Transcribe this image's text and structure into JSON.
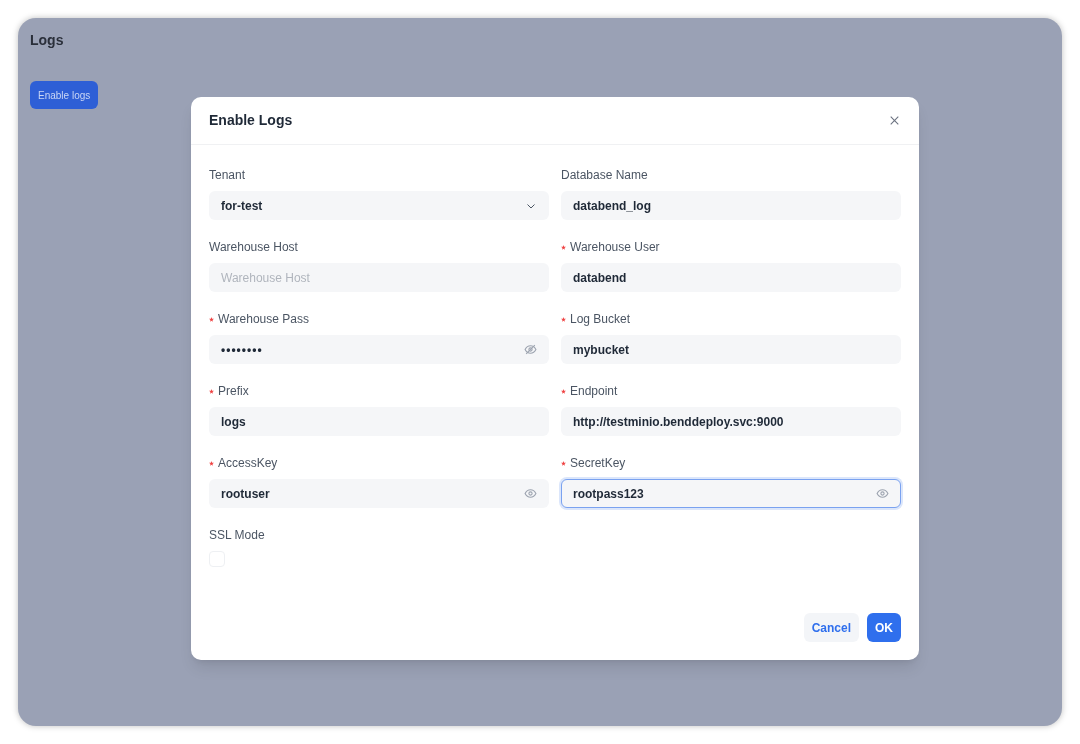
{
  "page": {
    "title": "Logs",
    "action_button": "Enable logs"
  },
  "dialog": {
    "title": "Enable Logs",
    "fields": [
      {
        "kind": "select",
        "label": "Tenant",
        "required": false,
        "value": "for-test",
        "focused": false
      },
      {
        "kind": "text",
        "label": "Database Name",
        "required": false,
        "value": "databend_log",
        "focused": false
      },
      {
        "kind": "text",
        "label": "Warehouse Host",
        "required": false,
        "placeholder": "Warehouse Host",
        "focused": false
      },
      {
        "kind": "text",
        "label": "Warehouse User",
        "required": true,
        "value": "databend",
        "focused": false
      },
      {
        "kind": "password",
        "label": "Warehouse Pass",
        "required": true,
        "value": "••••••••",
        "revealed": false,
        "focused": false
      },
      {
        "kind": "text",
        "label": "Log Bucket",
        "required": true,
        "value": "mybucket",
        "focused": false
      },
      {
        "kind": "text",
        "label": "Prefix",
        "required": true,
        "value": "logs",
        "focused": false
      },
      {
        "kind": "text",
        "label": "Endpoint",
        "required": true,
        "value": "http://testminio.benddeploy.svc:9000",
        "focused": false
      },
      {
        "kind": "password",
        "label": "AccessKey",
        "required": true,
        "value": "rootuser",
        "revealed": true,
        "focused": false
      },
      {
        "kind": "password",
        "label": "SecretKey",
        "required": true,
        "value": "rootpass123",
        "revealed": true,
        "focused": true
      },
      {
        "kind": "checkbox",
        "label": "SSL Mode",
        "required": false,
        "checked": false
      }
    ],
    "buttons": [
      {
        "label": "Cancel",
        "primary": false
      },
      {
        "label": "OK",
        "primary": true
      }
    ]
  }
}
